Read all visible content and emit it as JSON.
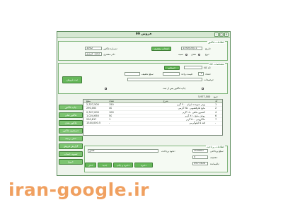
{
  "window": {
    "title": "فروش 99",
    "controls": [
      "-",
      "□",
      "x"
    ]
  },
  "top_group": {
    "title": "اطلاعات فاکتور",
    "invoice_number_label": "شماره فاکتور:",
    "invoice_number_value": "1002",
    "customer_label": "نام مشتری:",
    "customer_value": "محمد عزیزی",
    "select_customer_button": "انتخاب مشتری",
    "date_label": "تاریخ:",
    "date_value": "1392/05/11",
    "type_label": "نوع:",
    "radio_cash": "نقدی",
    "radio_credit": "نسیه"
  },
  "item_group": {
    "title": "مشخصات کالا",
    "code_label": "کد کالا:",
    "search_button": "جستجو",
    "qty_label": "تعداد:",
    "qty_value": "1",
    "price_label": "قیمت واحد:",
    "discount_label": "مبلغ تخفیف:",
    "desc_label": "توضیحات:",
    "add_button": "ثبت فروش",
    "note_label": "مبلغ کل:",
    "total_items_label": "جمع",
    "total_value": "5,977,500",
    "checkbox_label": "چاپ فاکتور پس از ثبت"
  },
  "grid": {
    "headers": [
      "مبلغ",
      "تعداد",
      "شرح",
      "کد"
    ],
    "rows": [
      [
        "2,327,500",
        "150",
        "پودر شوینده ایران ۳۰۰ گرم",
        "1"
      ],
      [
        "290,000",
        "40",
        "مایع ظرفشویی ۷۵۰ گرمی",
        "2"
      ],
      [
        "2,327,000",
        "100",
        "کنسرو ماهی ۱۸۰ گرم",
        "4"
      ],
      [
        "1,024,650",
        "50",
        "روغن مایع ۸۱۰ گرم",
        "6"
      ],
      [
        "290,617",
        "1",
        "ماکارونی ۵۰۰ گرم",
        "7"
      ],
      [
        "1344,000.5",
        "-",
        "قند ۵ کیلوگرمی",
        "-"
      ]
    ]
  },
  "side_buttons": [
    "چاپ فاکتور",
    "فاکتور قبلی",
    "فاکتور بعدی",
    "جستجوی فاکتور",
    "حذف ردیف",
    "گزارش فروش",
    "تسویه حساب",
    "خروج"
  ],
  "bottom_group": {
    "title": "اطلاعات پرداخت",
    "paid_label": "مبلغ پرداختی:",
    "paid_value": "200000",
    "discount_label": "تخفیف:",
    "discount_value": "0",
    "remain_label": "باقیمانده:",
    "remain_value": "5977500",
    "method_label": "نحوه پرداخت:",
    "method_value": "نقدی",
    "save_button": "ذخیره",
    "save_print_button": "ذخیره و چاپ",
    "new_button": "جدید",
    "delete_button": "حذف"
  },
  "watermark": "iran-google.ir"
}
